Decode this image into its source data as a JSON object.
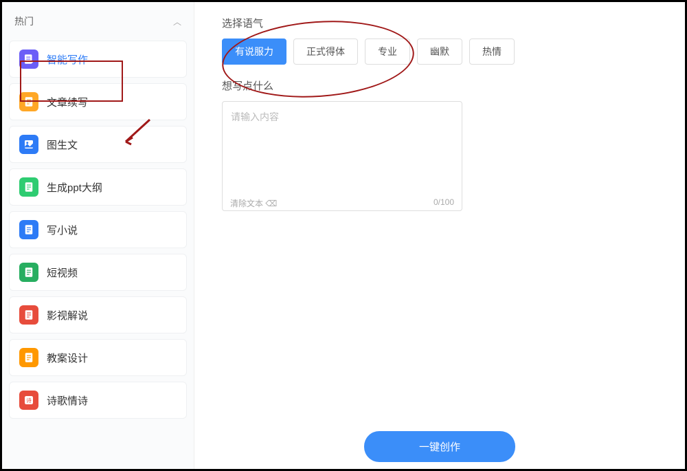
{
  "sidebar": {
    "header": "热门",
    "items": [
      {
        "label": "智能写作",
        "icon": "purple",
        "active": true
      },
      {
        "label": "文章续写",
        "icon": "orange"
      },
      {
        "label": "图生文",
        "icon": "blue"
      },
      {
        "label": "生成ppt大纲",
        "icon": "green"
      },
      {
        "label": "写小说",
        "icon": "blue"
      },
      {
        "label": "短视频",
        "icon": "green2"
      },
      {
        "label": "影视解说",
        "icon": "red"
      },
      {
        "label": "教案设计",
        "icon": "orange2"
      },
      {
        "label": "诗歌情诗",
        "icon": "red2"
      }
    ]
  },
  "main": {
    "tone_label": "选择语气",
    "tones": [
      {
        "label": "有说服力",
        "selected": true
      },
      {
        "label": "正式得体",
        "selected": false
      },
      {
        "label": "专业",
        "selected": false
      },
      {
        "label": "幽默",
        "selected": false
      },
      {
        "label": "热情",
        "selected": false
      }
    ],
    "content_label": "想写点什么",
    "placeholder": "请输入内容",
    "clear_label": "清除文本 ⌫",
    "counter": "0/100",
    "submit_label": "一键创作"
  }
}
